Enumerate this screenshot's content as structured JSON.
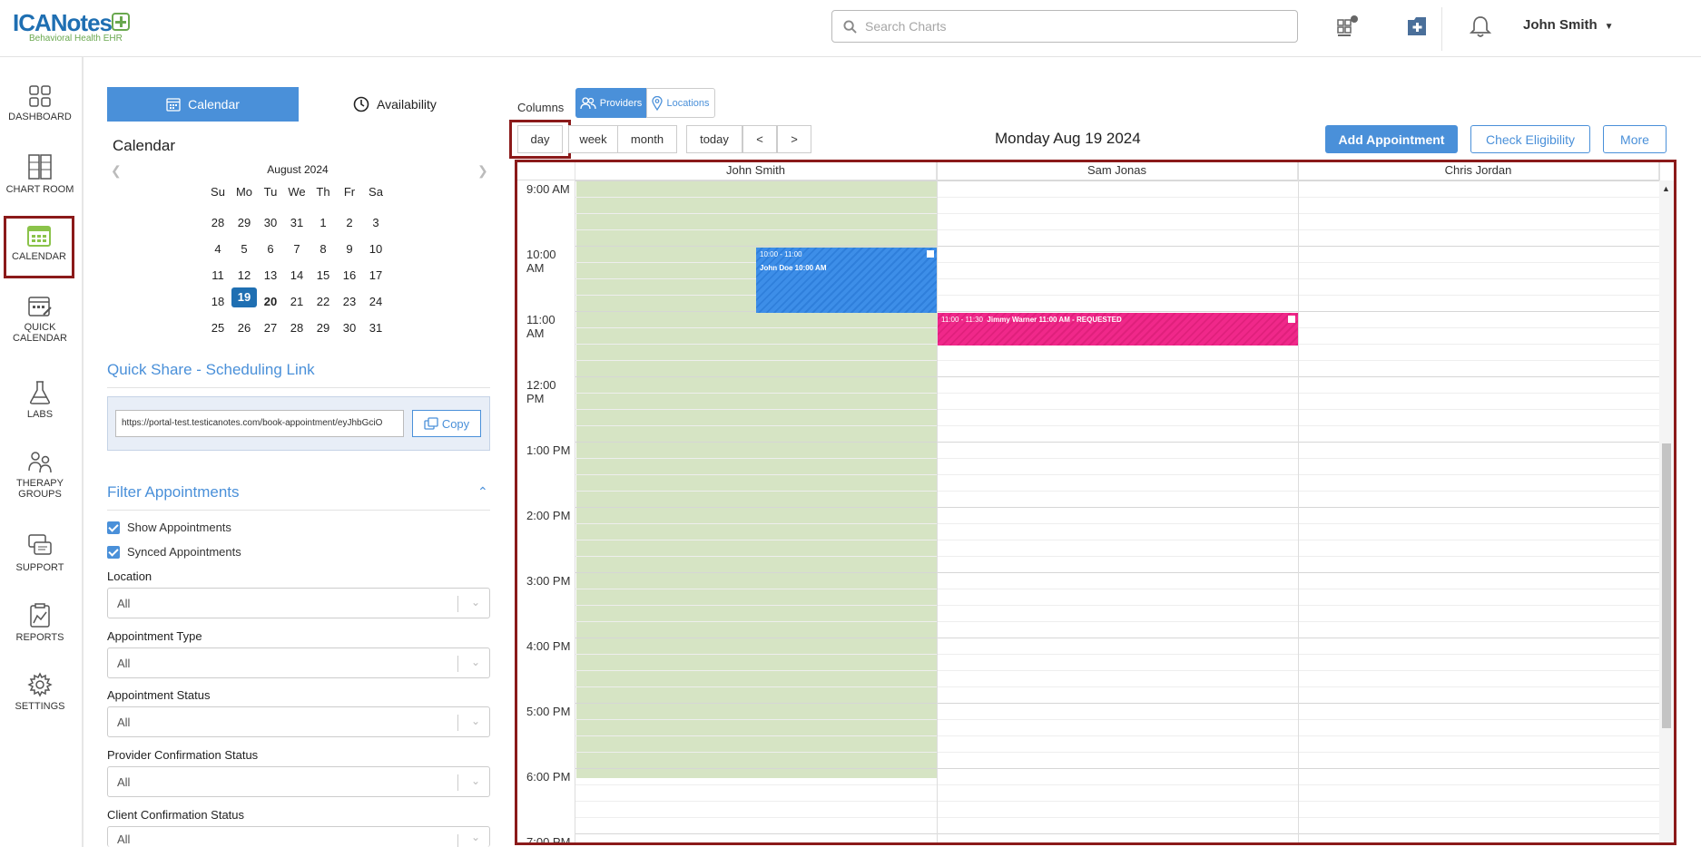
{
  "header": {
    "logo_main": "ICANotes",
    "logo_sub": "Behavioral Health EHR",
    "search_placeholder": "Search Charts",
    "user_name": "John Smith"
  },
  "nav": {
    "dashboard": "DASHBOARD",
    "chart_room": "CHART ROOM",
    "calendar": "CALENDAR",
    "quick_calendar_1": "QUICK",
    "quick_calendar_2": "CALENDAR",
    "labs": "LABS",
    "therapy_1": "THERAPY",
    "therapy_2": "GROUPS",
    "support": "SUPPORT",
    "reports": "REPORTS",
    "settings": "SETTINGS"
  },
  "tabs": {
    "calendar": "Calendar",
    "availability": "Availability"
  },
  "mini_calendar": {
    "title": "Calendar",
    "month": "August 2024",
    "dow": [
      "Su",
      "Mo",
      "Tu",
      "We",
      "Th",
      "Fr",
      "Sa"
    ],
    "weeks": [
      [
        "28",
        "29",
        "30",
        "31",
        "1",
        "2",
        "3"
      ],
      [
        "4",
        "5",
        "6",
        "7",
        "8",
        "9",
        "10"
      ],
      [
        "11",
        "12",
        "13",
        "14",
        "15",
        "16",
        "17"
      ],
      [
        "18",
        "19",
        "20",
        "21",
        "22",
        "23",
        "24"
      ],
      [
        "25",
        "26",
        "27",
        "28",
        "29",
        "30",
        "31"
      ]
    ],
    "selected": "19"
  },
  "share": {
    "title": "Quick Share - Scheduling Link",
    "url": "https://portal-test.testicanotes.com/book-appointment/eyJhbGciO",
    "copy": "Copy"
  },
  "filters": {
    "title": "Filter Appointments",
    "show": "Show Appointments",
    "synced": "Synced Appointments",
    "location_label": "Location",
    "location_value": "All",
    "type_label": "Appointment Type",
    "type_value": "All",
    "status_label": "Appointment Status",
    "status_value": "All",
    "provider_label": "Provider Confirmation Status",
    "provider_value": "All",
    "client_label": "Client Confirmation Status",
    "client_value": "All"
  },
  "toolbar": {
    "columns": "Columns",
    "providers": "Providers",
    "locations": "Locations",
    "day": "day",
    "week": "week",
    "month": "month",
    "today": "today",
    "prev": "<",
    "next": ">",
    "date_title": "Monday Aug 19 2024",
    "add": "Add Appointment",
    "eligibility": "Check Eligibility",
    "more": "More"
  },
  "grid": {
    "columns": [
      "John Smith",
      "Sam Jonas",
      "Chris Jordan"
    ],
    "times": [
      "9:00 AM",
      "10:00 AM",
      "11:00 AM",
      "12:00 PM",
      "1:00 PM",
      "2:00 PM",
      "3:00 PM",
      "4:00 PM",
      "5:00 PM",
      "6:00 PM",
      "7:00 PM"
    ]
  },
  "appointments": [
    {
      "time": "10:00 - 11:00",
      "title": "John Doe 10:00 AM",
      "color": "#3d8ee8"
    },
    {
      "time": "11:00 - 11:30",
      "title": "Jimmy Warner 11:00 AM - REQUESTED",
      "color": "#f0288a"
    }
  ]
}
